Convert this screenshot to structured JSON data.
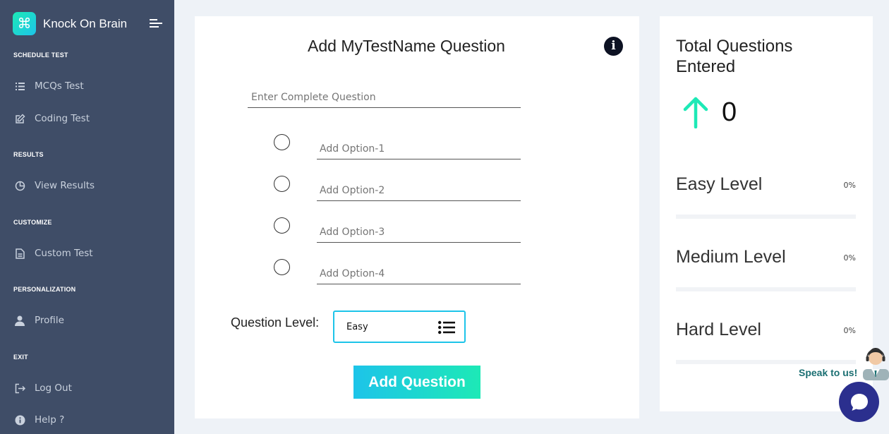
{
  "sidebar": {
    "brand": "Knock On Brain",
    "brand_logo": "⌘",
    "sections": [
      {
        "caption": "SCHEDULE TEST",
        "items": [
          {
            "label": "MCQs Test",
            "icon": "list-icon"
          },
          {
            "label": "Coding Test",
            "icon": "edit-icon"
          }
        ]
      },
      {
        "caption": "RESULTS",
        "items": [
          {
            "label": "View Results",
            "icon": "pie-chart-icon"
          }
        ]
      },
      {
        "caption": "CUSTOMIZE",
        "items": [
          {
            "label": "Custom Test",
            "icon": "file-icon"
          }
        ]
      },
      {
        "caption": "PERSONALIZATION",
        "items": [
          {
            "label": "Profile",
            "icon": "user-icon"
          }
        ]
      },
      {
        "caption": "EXIT",
        "items": [
          {
            "label": "Log Out",
            "icon": "logout-icon"
          },
          {
            "label": "Help ?",
            "icon": "help-icon"
          }
        ]
      }
    ]
  },
  "form": {
    "title": "Add MyTestName Question",
    "info_icon": "i",
    "question_placeholder": "Enter Complete Question",
    "options": [
      {
        "placeholder": "Add Option-1"
      },
      {
        "placeholder": "Add Option-2"
      },
      {
        "placeholder": "Add Option-3"
      },
      {
        "placeholder": "Add Option-4"
      }
    ],
    "level_label": "Question Level:",
    "level_value": "Easy",
    "submit_label": "Add Question"
  },
  "stats": {
    "title": "Total Questions Entered",
    "count": "0",
    "levels": [
      {
        "name": "Easy Level",
        "percent_label": "0%",
        "percent": 0
      },
      {
        "name": "Medium Level",
        "percent_label": "0%",
        "percent": 0
      },
      {
        "name": "Hard Level",
        "percent_label": "0%",
        "percent": 0
      }
    ]
  },
  "support": {
    "text": "Speak to us!"
  },
  "colors": {
    "sidebar_bg": "#3f4d67",
    "accent_teal": "#1de9b6",
    "accent_cyan": "#1dc4e9",
    "chat_bubble": "#2b2f8e"
  }
}
